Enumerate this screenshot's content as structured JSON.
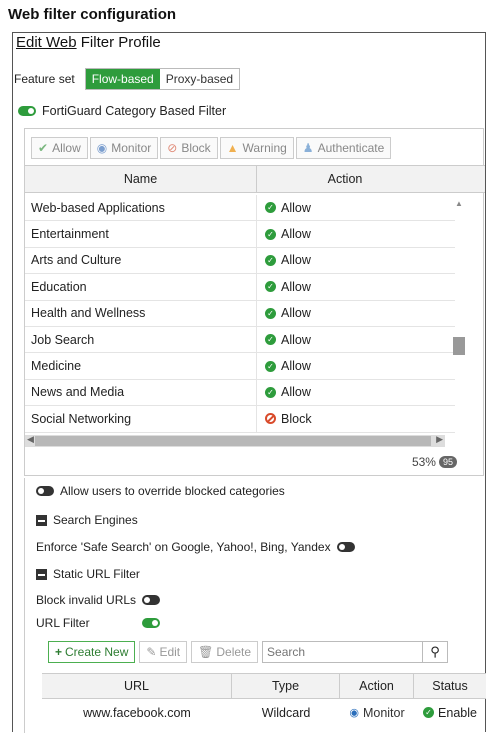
{
  "page_title": "Web filter configuration",
  "profile": {
    "title_underlined": "Edit Web",
    "title_rest": " Filter Profile"
  },
  "feature_set": {
    "label": "Feature set",
    "options": [
      "Flow-based",
      "Proxy-based"
    ],
    "selected": "Flow-based"
  },
  "fortiguard": {
    "label": "FortiGuard Category Based Filter",
    "enabled": true
  },
  "category_actions": [
    {
      "label": "Allow",
      "icon": "check-circle-icon"
    },
    {
      "label": "Monitor",
      "icon": "eye-icon"
    },
    {
      "label": "Block",
      "icon": "block-icon"
    },
    {
      "label": "Warning",
      "icon": "warning-icon"
    },
    {
      "label": "Authenticate",
      "icon": "user-icon"
    }
  ],
  "category_table": {
    "headers": [
      "Name",
      "Action"
    ],
    "rows": [
      {
        "name": "Web-based Applications",
        "action": "Allow"
      },
      {
        "name": "Entertainment",
        "action": "Allow"
      },
      {
        "name": "Arts and Culture",
        "action": "Allow"
      },
      {
        "name": "Education",
        "action": "Allow"
      },
      {
        "name": "Health and Wellness",
        "action": "Allow"
      },
      {
        "name": "Job Search",
        "action": "Allow"
      },
      {
        "name": "Medicine",
        "action": "Allow"
      },
      {
        "name": "News and Media",
        "action": "Allow"
      },
      {
        "name": "Social Networking",
        "action": "Block"
      }
    ],
    "percent": "53%",
    "count": "95"
  },
  "override": {
    "label": "Allow users to override blocked categories",
    "enabled": false
  },
  "search_engines": {
    "label": "Search Engines",
    "safe_search_label": "Enforce 'Safe Search' on Google, Yahoo!, Bing, Yandex",
    "safe_search_enabled": false
  },
  "static_url": {
    "label": "Static URL Filter",
    "block_invalid_label": "Block invalid URLs",
    "block_invalid_enabled": false,
    "url_filter_label": "URL Filter",
    "url_filter_enabled": true
  },
  "url_toolbar": {
    "create": "Create New",
    "edit": "Edit",
    "delete": "Delete",
    "search_placeholder": "Search"
  },
  "url_table": {
    "headers": [
      "URL",
      "Type",
      "Action",
      "Status"
    ],
    "rows": [
      {
        "url": "www.facebook.com",
        "type": "Wildcard",
        "action": "Monitor",
        "status": "Enable"
      }
    ]
  },
  "colors": {
    "accent_green": "#2e9c3c",
    "block_red": "#d94b2b",
    "warning_orange": "#f0a020"
  }
}
